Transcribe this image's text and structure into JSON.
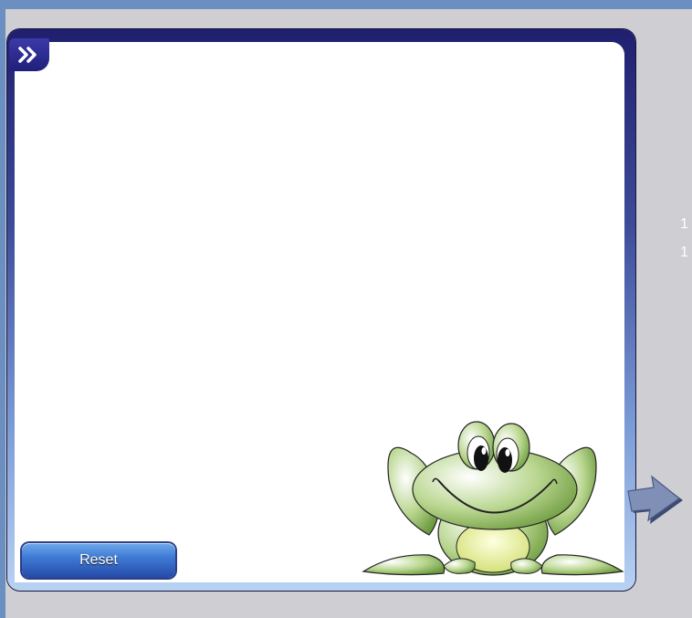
{
  "header": {
    "expand_icon": "double-chevron-right-icon"
  },
  "controls": {
    "reset_label": "Reset"
  },
  "side_numbers": [
    "1",
    "1"
  ],
  "navigation": {
    "next_icon": "arrow-right-icon"
  },
  "mascot": {
    "name": "frog"
  },
  "colors": {
    "page_background": "#6b8fc0",
    "stage_background": "#cfcfd3",
    "panel_inner": "#ffffff",
    "frame_dark": "#1f1f6e",
    "frame_light": "#b8d2f3",
    "reset_button": "#3f7bd6",
    "frog_green": "#8dbb60"
  }
}
